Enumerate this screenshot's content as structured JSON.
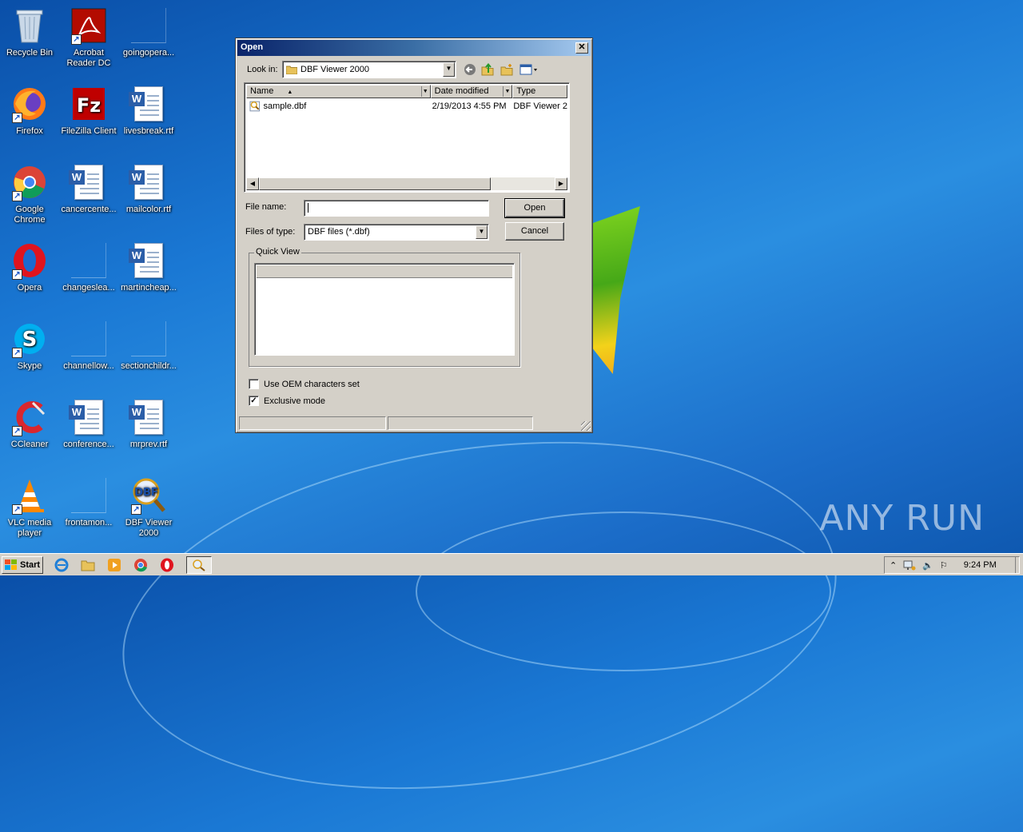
{
  "desktop": {
    "icons": [
      {
        "label": "Recycle Bin"
      },
      {
        "label": "Acrobat Reader DC"
      },
      {
        "label": "goingopera..."
      },
      {
        "label": "Firefox"
      },
      {
        "label": "FileZilla Client"
      },
      {
        "label": "livesbreak.rtf"
      },
      {
        "label": "Google Chrome"
      },
      {
        "label": "cancercente..."
      },
      {
        "label": "mailcolor.rtf"
      },
      {
        "label": "Opera"
      },
      {
        "label": "changeslea..."
      },
      {
        "label": "martincheap..."
      },
      {
        "label": "Skype"
      },
      {
        "label": "channellow..."
      },
      {
        "label": "sectionchildr..."
      },
      {
        "label": "CCleaner"
      },
      {
        "label": "conference..."
      },
      {
        "label": "mrprev.rtf"
      },
      {
        "label": "VLC media player"
      },
      {
        "label": "frontamon..."
      },
      {
        "label": "DBF Viewer 2000"
      }
    ],
    "watermark": "ANY RUN"
  },
  "dialog": {
    "title": "Open",
    "close_glyph": "✕",
    "look_in_label": "Look in:",
    "look_in_value": "DBF Viewer 2000",
    "columns": [
      {
        "label": "Name"
      },
      {
        "label": "Date modified"
      },
      {
        "label": "Type"
      }
    ],
    "files": [
      {
        "name": "sample.dbf",
        "date": "2/19/2013 4:55 PM",
        "type": "DBF Viewer 2"
      }
    ],
    "file_name_label": "File name:",
    "file_name_value": "",
    "files_of_type_label": "Files of type:",
    "files_of_type_value": "DBF files (*.dbf)",
    "open_button": "Open",
    "cancel_button": "Cancel",
    "quick_view_label": "Quick View",
    "oem_label": "Use OEM characters set",
    "oem_checked": false,
    "exclusive_label": "Exclusive mode",
    "exclusive_checked": true
  },
  "taskbar": {
    "start_label": "Start",
    "clock": "9:24 PM"
  }
}
